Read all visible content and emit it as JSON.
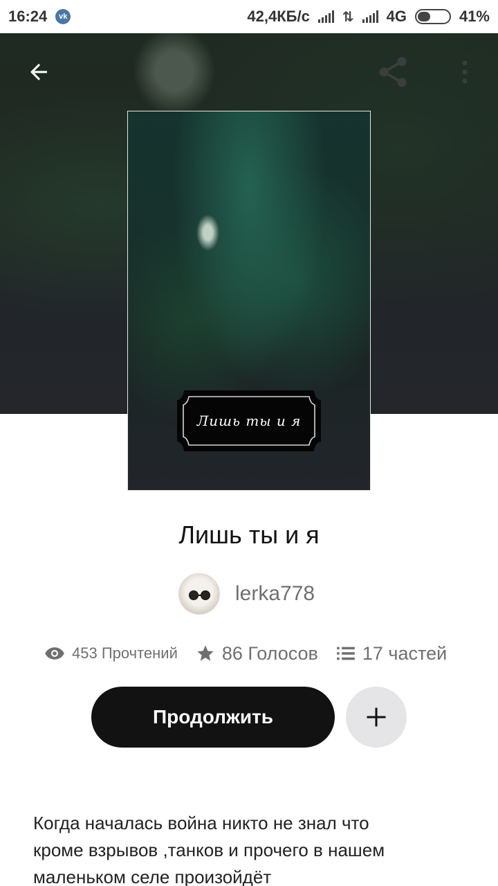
{
  "status_bar": {
    "time": "16:24",
    "speed": "42,4КБ/с",
    "network": "4G",
    "battery": "41%",
    "battery_level": 0.41,
    "vk_label": "vk"
  },
  "top_bar": {
    "back_icon": "arrow-left-icon",
    "share_icon": "share-icon",
    "more_icon": "more-vertical-icon"
  },
  "cover": {
    "text": "Лишь ты и я"
  },
  "story": {
    "title": "Лишь ты и я",
    "author": "lerka778",
    "stats": {
      "reads": "453 Прочтений",
      "votes": "86 Голосов",
      "parts": "17 частей"
    },
    "continue_label": "Продолжить",
    "description": "Когда началась война никто не знал что кроме взрывов ,танков и прочего в нашем маленьком селе произойдёт"
  },
  "colors": {
    "primary_button": "#121212",
    "secondary_button": "#e5e4e6",
    "muted_text": "#6f6f6f"
  }
}
